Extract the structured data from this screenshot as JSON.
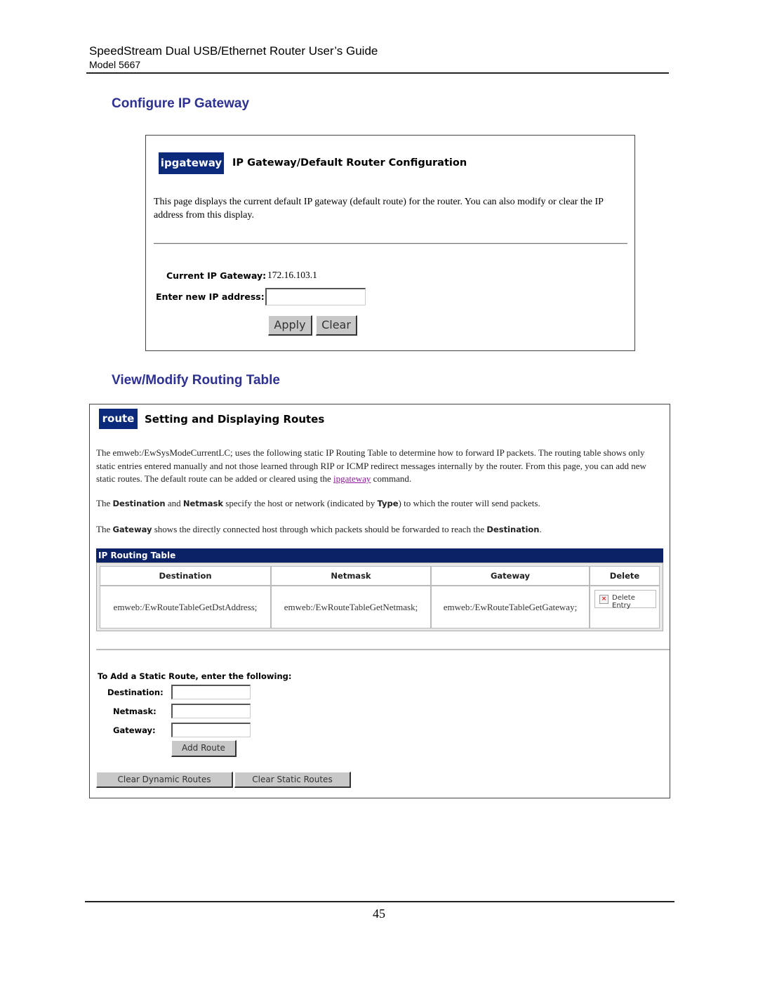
{
  "header": {
    "title": "SpeedStream Dual USB/Ethernet Router User’s Guide",
    "model": "Model 5667"
  },
  "section1": {
    "title": "Configure IP Gateway",
    "screen": {
      "tag": "ipgateway",
      "heading": "IP Gateway/Default Router Configuration",
      "description": "This page displays the current default IP gateway (default route) for the router. You can also modify or clear the IP address from this display.",
      "current_label": "Current IP Gateway:",
      "current_value": "172.16.103.1",
      "new_label": "Enter new IP address:",
      "new_value": "",
      "apply_label": "Apply",
      "clear_label": "Clear"
    }
  },
  "section2": {
    "title": "View/Modify Routing Table",
    "screen": {
      "tag": "route",
      "heading": "Setting and Displaying Routes",
      "para1_pre": "The emweb:/EwSysModeCurrentLC; uses the following static IP Routing Table to determine how to forward IP packets. The routing table shows only static entries entered manually and not those learned through RIP or ICMP redirect messages internally by the router. From this page, you can add new static routes. The default route can be added or cleared using the ",
      "para1_link": "ipgateway",
      "para1_post": " command.",
      "para2": {
        "t1": "The ",
        "b1": "Destination",
        "t2": " and ",
        "b2": "Netmask",
        "t3": " specify the host or network (indicated by ",
        "b3": "Type",
        "t4": ") to which the router will send packets."
      },
      "para3": {
        "t1": "The ",
        "b1": "Gateway",
        "t2": " shows the directly connected host through which packets should be forwarded to reach the ",
        "b2": "Destination",
        "t3": "."
      },
      "table": {
        "title": "IP Routing Table",
        "columns": [
          "Destination",
          "Netmask",
          "Gateway",
          "Delete"
        ],
        "rows": [
          {
            "destination": "emweb:/EwRouteTableGetDstAddress;",
            "netmask": "emweb:/EwRouteTableGetNetmask;",
            "gateway": "emweb:/EwRouteTableGetGateway;",
            "delete_label": "Delete Entry"
          }
        ]
      },
      "add": {
        "heading": "To Add a Static Route, enter the following:",
        "destination_label": "Destination:",
        "netmask_label": "Netmask:",
        "gateway_label": "Gateway:",
        "destination_value": "",
        "netmask_value": "",
        "gateway_value": "",
        "add_button": "Add Route"
      },
      "clear_dynamic_button": "Clear Dynamic Routes",
      "clear_static_button": "Clear Static Routes"
    }
  },
  "footer": {
    "page_number": "45"
  }
}
